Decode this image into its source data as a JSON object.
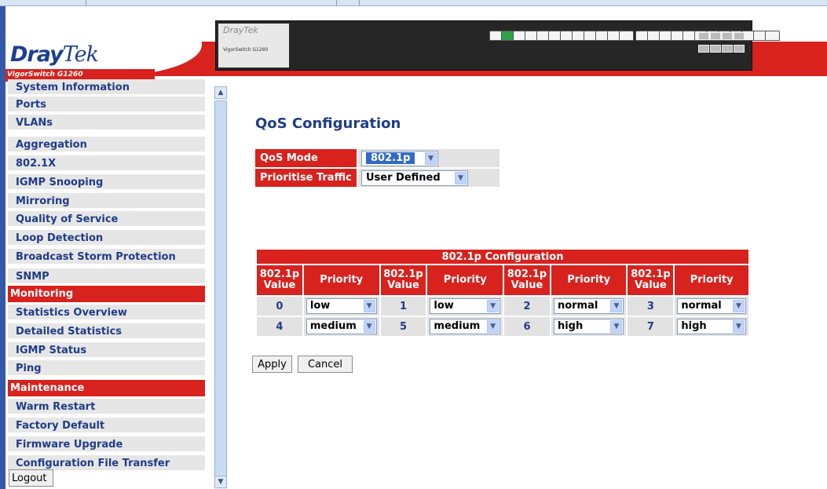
{
  "header": {
    "brand_dray": "Dray",
    "brand_tek": "Tek",
    "model": "VigorSwitch G1260",
    "faceplate_logo": "DrayTek",
    "faceplate_model": "VigorSwitch G1260"
  },
  "sidebar": {
    "items": [
      {
        "label": "System Information",
        "type": "item"
      },
      {
        "label": "Ports",
        "type": "item"
      },
      {
        "label": "VLANs",
        "type": "item"
      },
      {
        "label": "Aggregation",
        "type": "item"
      },
      {
        "label": "802.1X",
        "type": "item"
      },
      {
        "label": "IGMP Snooping",
        "type": "item"
      },
      {
        "label": "Mirroring",
        "type": "item"
      },
      {
        "label": "Quality of Service",
        "type": "item"
      },
      {
        "label": "Loop Detection",
        "type": "item"
      },
      {
        "label": "Broadcast Storm Protection",
        "type": "item"
      },
      {
        "label": "SNMP",
        "type": "item"
      },
      {
        "label": "Monitoring",
        "type": "section"
      },
      {
        "label": "Statistics Overview",
        "type": "item"
      },
      {
        "label": "Detailed Statistics",
        "type": "item"
      },
      {
        "label": "IGMP Status",
        "type": "item"
      },
      {
        "label": "Ping",
        "type": "item"
      },
      {
        "label": "Maintenance",
        "type": "section"
      },
      {
        "label": "Warm Restart",
        "type": "item"
      },
      {
        "label": "Factory Default",
        "type": "item"
      },
      {
        "label": "Firmware Upgrade",
        "type": "item"
      },
      {
        "label": "Configuration File Transfer",
        "type": "item"
      }
    ],
    "logout_label": "Logout"
  },
  "main": {
    "title": "QoS Configuration",
    "qos_mode_label": "QoS Mode",
    "qos_mode_value": "802.1p",
    "prioritise_label": "Prioritise Traffic",
    "prioritise_value": "User Defined",
    "table": {
      "caption": "802.1p Configuration",
      "value_header": "802.1p Value",
      "priority_header": "Priority",
      "rows": [
        [
          {
            "value": "0",
            "priority": "low"
          },
          {
            "value": "1",
            "priority": "low"
          },
          {
            "value": "2",
            "priority": "normal"
          },
          {
            "value": "3",
            "priority": "normal"
          }
        ],
        [
          {
            "value": "4",
            "priority": "medium"
          },
          {
            "value": "5",
            "priority": "medium"
          },
          {
            "value": "6",
            "priority": "high"
          },
          {
            "value": "7",
            "priority": "high"
          }
        ]
      ]
    },
    "apply_label": "Apply",
    "cancel_label": "Cancel"
  },
  "colors": {
    "brand_red": "#d7221e",
    "brand_blue": "#1f3c88",
    "menu_bg": "#e6e6e6",
    "cell_bg": "#e2e2e2"
  }
}
